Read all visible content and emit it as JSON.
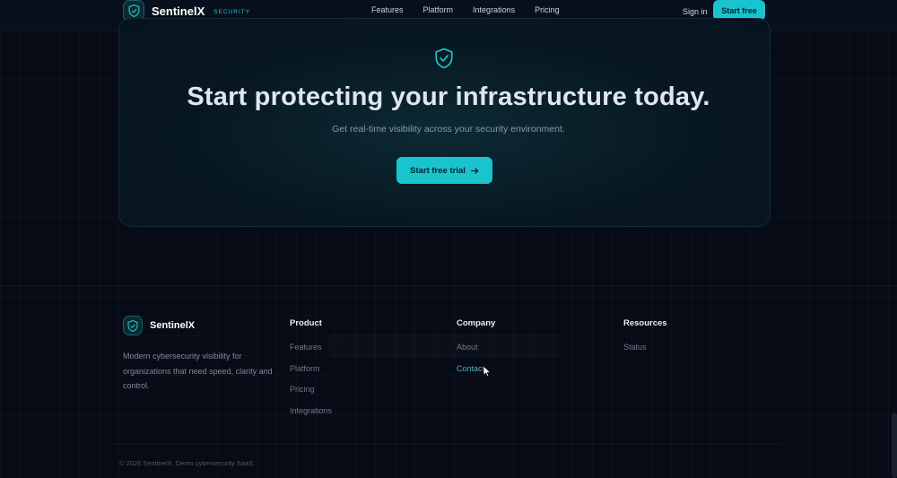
{
  "header": {
    "brand_name": "SentinelX",
    "brand_tag": "SECURITY",
    "nav": [
      "Features",
      "Platform",
      "Integrations",
      "Pricing"
    ],
    "sign_in": "Sign in",
    "cta": "Start free"
  },
  "hero": {
    "title": "Start protecting your infrastructure today.",
    "subtitle": "Get real-time visibility across your security environment.",
    "cta": "Start free trial",
    "icon": "shield-check-icon"
  },
  "footer": {
    "brand_name": "SentinelX",
    "description": "Modern cybersecurity visibility for organizations that need speed, clarity and control.",
    "columns": [
      {
        "title": "Product",
        "links": [
          "Features",
          "Platform",
          "Pricing",
          "Integrations"
        ]
      },
      {
        "title": "Company",
        "links": [
          "About",
          "Contact"
        ]
      },
      {
        "title": "Resources",
        "links": [
          "Status"
        ]
      }
    ],
    "copyright": "© 2026 SentinelX. Demo cybersecurity SaaS."
  },
  "colors": {
    "accent": "#19c4cf",
    "background": "#060b15"
  }
}
